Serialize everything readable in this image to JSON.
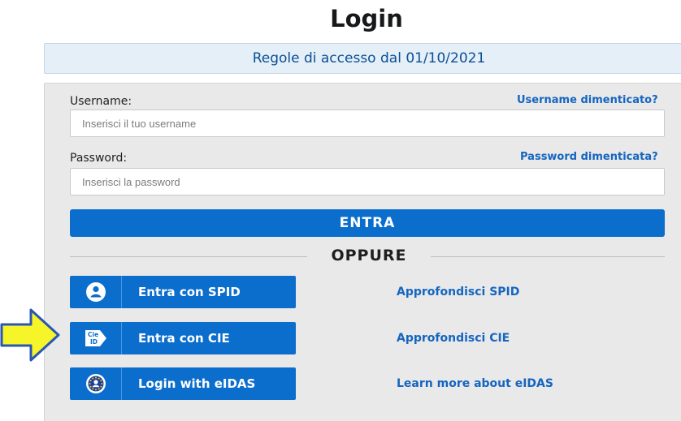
{
  "title": "Login",
  "notice": "Regole di accesso dal 01/10/2021",
  "form": {
    "username_label": "Username:",
    "username_forgot": "Username dimenticato?",
    "username_placeholder": "Inserisci il tuo username",
    "password_label": "Password:",
    "password_forgot": "Password dimenticata?",
    "password_placeholder": "Inserisci la password",
    "submit_label": "ENTRA"
  },
  "separator": "OPPURE",
  "identity_providers": [
    {
      "label": "Entra con SPID",
      "icon": "user-icon",
      "more": "Approfondisci SPID"
    },
    {
      "label": "Entra con CIE",
      "icon": "cie-id-icon",
      "more": "Approfondisci CIE"
    },
    {
      "label": "Login with eIDAS",
      "icon": "eidas-icon",
      "more": "Learn more about eIDAS"
    }
  ],
  "cie_icon_text": [
    "Cie",
    "ID"
  ],
  "colors": {
    "primary": "#0b6ecd",
    "link": "#1565c0",
    "panel": "#e9e9e9",
    "notice_bg": "#e5eff7",
    "arrow": "#f5f52a"
  }
}
